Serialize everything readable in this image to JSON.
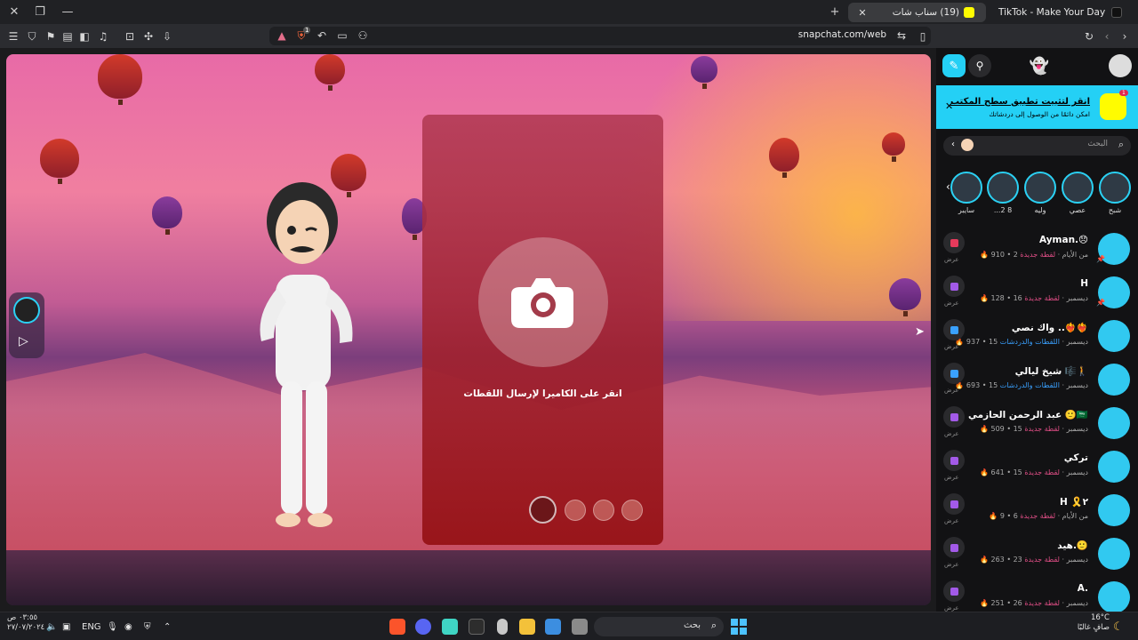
{
  "browser": {
    "tabs": [
      {
        "title": "TikTok - Make Your Day",
        "active": false
      },
      {
        "title": "(19) سناب شات",
        "active": true
      }
    ],
    "url": "snapchat.com/web",
    "window_controls": {
      "close": "✕",
      "restore": "❐",
      "minimize": "—"
    },
    "new_tab": "+",
    "brave_badge": "1"
  },
  "stage": {
    "camera_prompt": "انقر على الكاميرا لإرسال اللقطات"
  },
  "panel": {
    "banner": {
      "title": "انقر لتثبيت تطبيق سطح المكتب",
      "subtitle": "امكن دائمًا من الوصول إلى دردشاتك",
      "close": "✕",
      "badge": "1"
    },
    "search_placeholder": "البحث",
    "stories": [
      {
        "name": "شبح"
      },
      {
        "name": "عصي"
      },
      {
        "name": "وليه"
      },
      {
        "name": "...2 8"
      },
      {
        "name": "سايبر"
      }
    ],
    "chats": [
      {
        "name": "Ayman.😞",
        "status": "لقطة جديدة",
        "time": "2 من الأيام",
        "streak": "910",
        "pinned": true,
        "action_label": "عرض",
        "action_color": "#e63a5c"
      },
      {
        "name": "H",
        "status": "لقطة جديدة",
        "time": "16 ديسمبر",
        "streak": "128",
        "pinned": true,
        "action_label": "عرض",
        "action_color": "#a35ae8"
      },
      {
        "name": "واك نصي ..❤️‍🔥❤️‍🔥",
        "status": "اللقطات والدردشات",
        "time": "15 ديسمبر",
        "streak": "937",
        "pinned": false,
        "action_label": "عرض",
        "action_color": "#3aa1ff"
      },
      {
        "name": "شيخ ليالي 🎼🚶",
        "status": "اللقطات والدردشات",
        "time": "15 ديسمبر",
        "streak": "693",
        "pinned": false,
        "action_label": "عرض",
        "action_color": "#3aa1ff"
      },
      {
        "name": "عبد الرحمن الحازمي 🙂🇸🇦",
        "status": "لقطة جديدة",
        "time": "15 ديسمبر",
        "streak": "509",
        "pinned": false,
        "action_label": "عرض",
        "action_color": "#a35ae8"
      },
      {
        "name": "تركي",
        "status": "لقطة جديدة",
        "time": "15 ديسمبر",
        "streak": "641",
        "pinned": false,
        "action_label": "عرض",
        "action_color": "#a35ae8"
      },
      {
        "name": "H 🎗️٢",
        "status": "لقطة جديدة",
        "time": "6 من الأيام",
        "streak": "9",
        "pinned": false,
        "action_label": "عرض",
        "action_color": "#a35ae8"
      },
      {
        "name": "هيد.🙂",
        "status": "لقطة جديدة",
        "time": "23 ديسمبر",
        "streak": "263",
        "pinned": false,
        "action_label": "عرض",
        "action_color": "#a35ae8"
      },
      {
        "name": "A.",
        "status": "لقطة جديدة",
        "time": "26 ديسمبر",
        "streak": "251",
        "pinned": false,
        "action_label": "عرض",
        "action_color": "#a35ae8"
      }
    ]
  },
  "taskbar": {
    "time": "٠٣:٥٥ ص",
    "date": "٢٧/٠٧/٢٠٢٤",
    "language": "ENG",
    "search_placeholder": "بحث",
    "weather_temp": "16°C",
    "weather_desc": "صافٍ غالبًا"
  },
  "colors": {
    "snap_blue": "#24d0f5",
    "snap_pink": "#e04e86",
    "panel_bg": "#121214"
  }
}
